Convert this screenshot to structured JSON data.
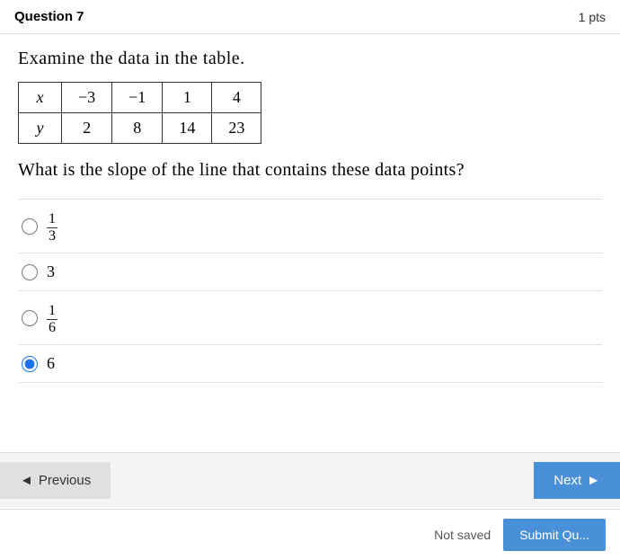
{
  "header": {
    "question_label": "Question 7",
    "points_label": "1 pts"
  },
  "question": {
    "examine_text": "Examine the data in the table.",
    "table": {
      "row_x_label": "x",
      "row_y_label": "y",
      "x_values": [
        "-3",
        "-1",
        "1",
        "4"
      ],
      "y_values": [
        "2",
        "8",
        "14",
        "23"
      ]
    },
    "slope_text": "What is the slope of the line that contains these data points?"
  },
  "options": [
    {
      "id": "opt1",
      "display": "fraction",
      "numerator": "1",
      "denominator": "3",
      "checked": false
    },
    {
      "id": "opt2",
      "display": "whole",
      "value": "3",
      "checked": false
    },
    {
      "id": "opt3",
      "display": "fraction",
      "numerator": "1",
      "denominator": "6",
      "checked": false
    },
    {
      "id": "opt4",
      "display": "whole",
      "value": "6",
      "checked": true
    }
  ],
  "navigation": {
    "previous_label": "Previous",
    "next_label": "Next"
  },
  "submit_bar": {
    "not_saved_label": "Not saved",
    "submit_label": "Submit Qu..."
  }
}
